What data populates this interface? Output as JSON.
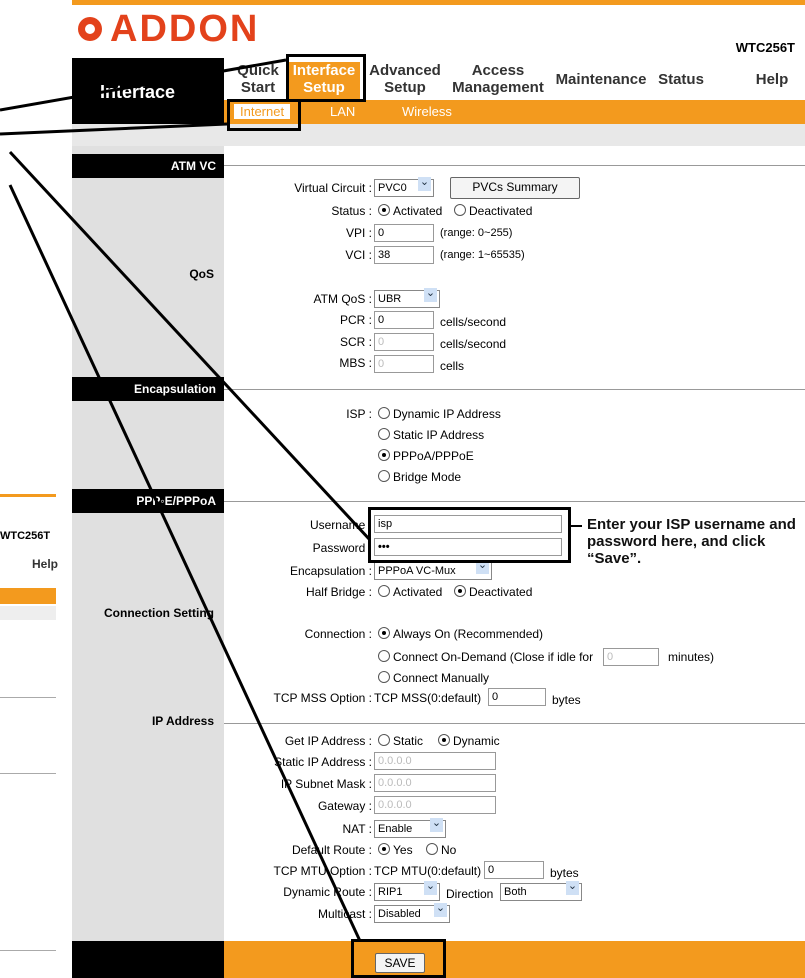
{
  "brand": {
    "logo": "ADDON",
    "model": "WTC256T"
  },
  "nav": {
    "section_label": "Interface",
    "items": [
      "Quick\nStart",
      "Interface\nSetup",
      "Advanced\nSetup",
      "Access\nManagement",
      "Maintenance",
      "Status",
      "Help"
    ],
    "active": "Interface Setup",
    "sub_items": [
      "Internet",
      "LAN",
      "Wireless"
    ]
  },
  "sections": {
    "atm": "ATM VC",
    "qos": "QoS",
    "encap": "Encapsulation",
    "pppoe": "PPP◦E/PPPoA",
    "conn": "Connection Setting",
    "ip": "IP Address"
  },
  "atm": {
    "vc_label": "Virtual Circuit :",
    "vc_value": "PVC0",
    "summary_btn": "PVCs Summary",
    "status_label": "Status :",
    "status_opts": [
      "Activated",
      "Deactivated"
    ],
    "vpi_label": "VPI :",
    "vpi_value": "0",
    "vpi_range": "(range: 0~255)",
    "vci_label": "VCI :",
    "vci_value": "38",
    "vci_range": "(range: 1~65535)"
  },
  "qos": {
    "atm_qos_label": "ATM QoS :",
    "atm_qos_value": "UBR",
    "pcr_label": "PCR :",
    "pcr_value": "0",
    "pcr_unit": "cells/second",
    "scr_label": "SCR :",
    "scr_value": "0",
    "scr_unit": "cells/second",
    "mbs_label": "MBS :",
    "mbs_value": "0",
    "mbs_unit": "cells"
  },
  "isp": {
    "label": "ISP :",
    "options": [
      "Dynamic IP Address",
      "Static IP Address",
      "PPPoA/PPPoE",
      "Bridge Mode"
    ],
    "selected_index": 2
  },
  "ppp": {
    "username_label": "Username :",
    "username_value": "isp",
    "password_label": "Password :",
    "password_value": "•••",
    "encap_label": "Encapsulation :",
    "encap_value": "PPPoA VC-Mux",
    "half_bridge_label": "Half Bridge :",
    "half_bridge_opts": [
      "Activated",
      "Deactivated"
    ]
  },
  "conn": {
    "label": "Connection :",
    "opt_always": "Always On (Recommended)",
    "opt_demand": "Connect On-Demand (Close if idle for",
    "demand_value": "0",
    "demand_unit": "minutes)",
    "opt_manual": "Connect Manually",
    "mss_label": "TCP MSS Option :",
    "mss_text": "TCP MSS(0:default)",
    "mss_value": "0",
    "mss_unit": "bytes"
  },
  "ip": {
    "get_label": "Get IP Address :",
    "get_opts": [
      "Static",
      "Dynamic"
    ],
    "static_label": "Static IP Address :",
    "static_value": "0.0.0.0",
    "mask_label": "IP Subnet Mask :",
    "mask_value": "0.0.0.0",
    "gw_label": "Gateway :",
    "gw_value": "0.0.0.0",
    "nat_label": "NAT :",
    "nat_value": "Enable",
    "route_label": "Default Route :",
    "route_opts": [
      "Yes",
      "No"
    ],
    "mtu_label": "TCP MTU Option :",
    "mtu_text": "TCP MTU(0:default)",
    "mtu_value": "0",
    "mtu_unit": "bytes",
    "dyn_label": "Dynamic Route :",
    "dyn_value": "RIP1",
    "dir_label": "Direction",
    "dir_value": "Both",
    "mcast_label": "Multicast :",
    "mcast_value": "Disabled"
  },
  "save_label": "SAVE",
  "callout": "Enter your ISP username and password here, and click “Save”.",
  "ghost": {
    "model": "WTC256T",
    "help": "Help"
  }
}
